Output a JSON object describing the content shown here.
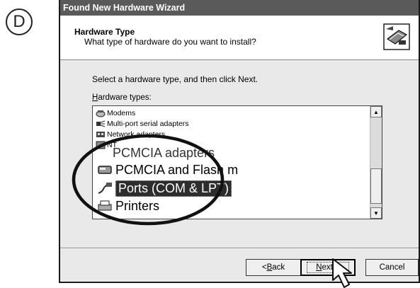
{
  "step_letter": "D",
  "window": {
    "title": "Found New Hardware Wizard",
    "header_title": "Hardware Type",
    "header_subtitle": "What type of hardware do you want to install?",
    "instruction": "Select a hardware type, and then click Next.",
    "list_label_accel": "H",
    "list_label_rest": "ardware types:"
  },
  "hardware_types": [
    {
      "label": "Modems",
      "icon": "modem-icon"
    },
    {
      "label": "Multi-port serial adapters",
      "icon": "serial-adapter-icon"
    },
    {
      "label": "Network adapters",
      "icon": "network-adapter-icon"
    },
    {
      "label": "NT",
      "icon": "nt-icon"
    },
    {
      "label": "PCMCIA adapters",
      "icon": "pcmcia-icon"
    },
    {
      "label": "PCMCIA and Flash m",
      "icon": "pcmcia-flash-icon"
    },
    {
      "label": "Ports (COM & LPT)",
      "icon": "port-connector-icon",
      "selected": true
    },
    {
      "label": "Printers",
      "icon": "printer-icon"
    }
  ],
  "buttons": {
    "back_pre": "< ",
    "back_accel": "B",
    "back_rest": "ack",
    "next_accel": "N",
    "next_rest": "ext",
    "next_suffix": " >",
    "cancel": "Cancel"
  },
  "colors": {
    "titlebar": "#5a5a5a",
    "selection": "#2d2d2d",
    "dialog_bg": "#e9e9e9"
  }
}
